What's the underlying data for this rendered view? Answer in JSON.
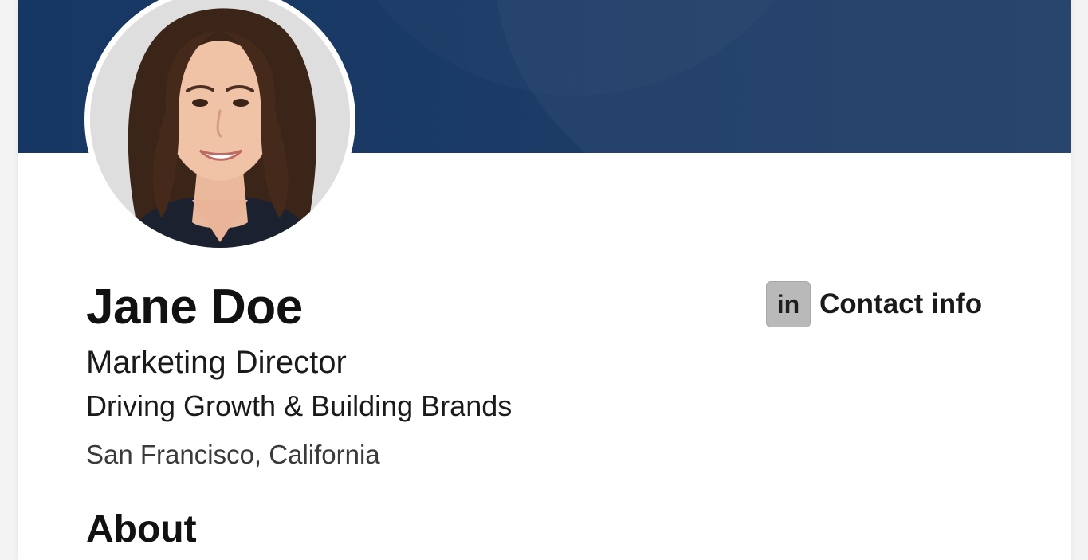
{
  "profile": {
    "name": "Jane Doe",
    "headline": "Marketing Director",
    "tagline": "Driving Growth & Building Brands",
    "location": "San Francisco, California"
  },
  "contact": {
    "icon": "linkedin-icon",
    "icon_text": "in",
    "label": "Contact info"
  },
  "sections": {
    "about_heading": "About"
  },
  "colors": {
    "banner": "#1b3b66",
    "background": "#ffffff",
    "text": "#111111",
    "icon_bg": "#b9b9b9"
  }
}
